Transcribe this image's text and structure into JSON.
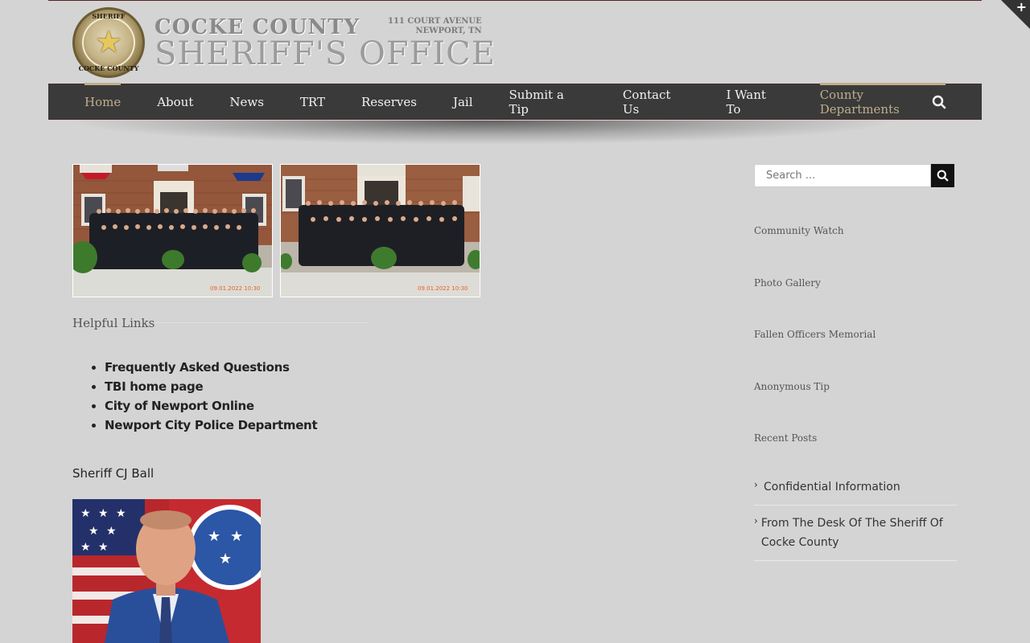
{
  "badge": {
    "top": "SHERIFF",
    "bottom": "COCKE COUNTY"
  },
  "logo": {
    "line1": "COCKE COUNTY",
    "line2": "SHERIFF'S OFFICE",
    "addr1": "111 COURT AVENUE",
    "addr2": "NEWPORT, TN"
  },
  "nav": {
    "items": [
      {
        "label": "Home",
        "active": true
      },
      {
        "label": "About"
      },
      {
        "label": "News"
      },
      {
        "label": "TRT"
      },
      {
        "label": "Reserves"
      },
      {
        "label": "Jail"
      },
      {
        "label": "Submit a Tip"
      },
      {
        "label": "Contact Us"
      },
      {
        "label": "I Want To"
      },
      {
        "label": "County Departments",
        "active": true
      }
    ]
  },
  "photos": {
    "stamp1": "09.01.2022 10:30",
    "stamp2": "09.01.2022 10:30"
  },
  "helpful": {
    "title": "Helpful Links",
    "links": [
      "Frequently Asked Questions",
      "TBI home page",
      "City of Newport Online",
      "Newport City Police Department"
    ]
  },
  "sheriff": {
    "name": "Sheriff CJ Ball"
  },
  "sidebar": {
    "search_placeholder": "Search ...",
    "links": [
      "Community Watch",
      "Photo Gallery",
      "Fallen Officers Memorial",
      "Anonymous Tip"
    ],
    "recent_title": "Recent Posts",
    "recent_posts": [
      "Confidential Information",
      "From The Desk Of The Sheriff Of Cocke County"
    ]
  },
  "colors": {
    "accent": "#bfae8a",
    "nav_bg": "#3a3a3a",
    "page_bg": "#d4d4d4"
  }
}
